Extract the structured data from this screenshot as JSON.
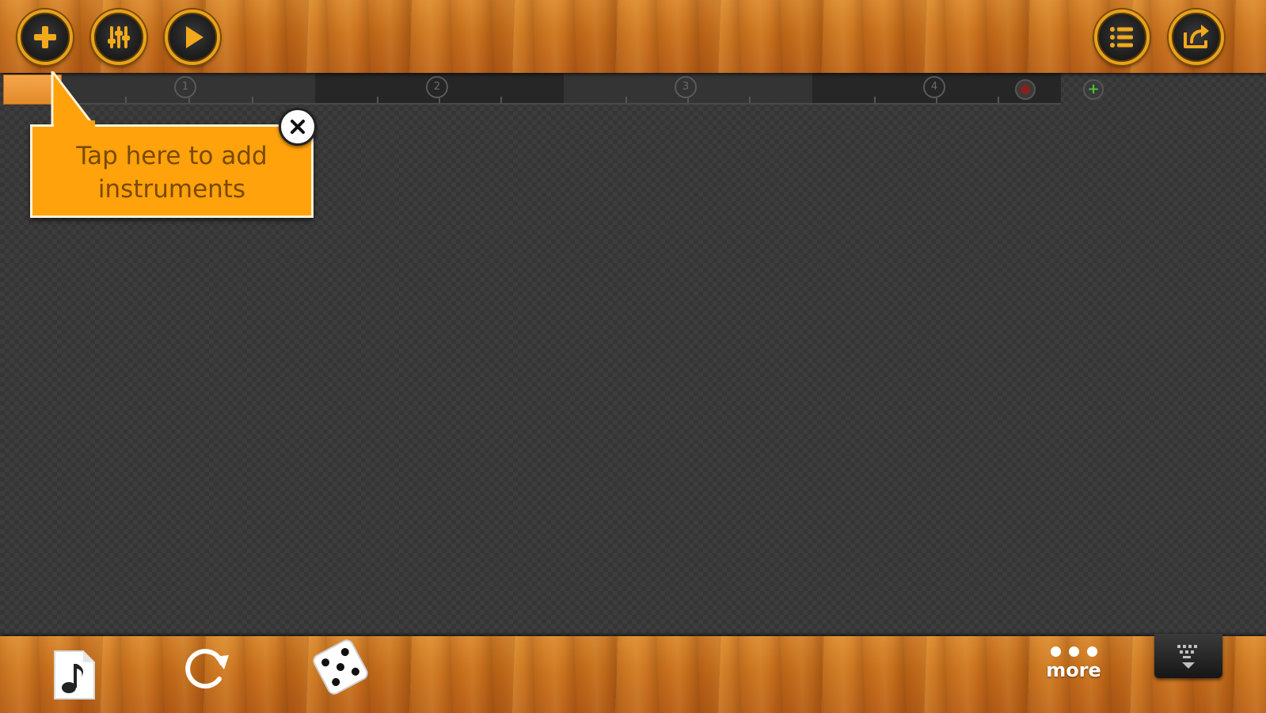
{
  "toolbar": {
    "left_buttons": [
      {
        "name": "add-instrument-button",
        "icon": "plus-icon"
      },
      {
        "name": "mixer-button",
        "icon": "sliders-icon"
      },
      {
        "name": "play-button",
        "icon": "play-icon"
      }
    ],
    "right_buttons": [
      {
        "name": "song-list-button",
        "icon": "list-icon"
      },
      {
        "name": "share-button",
        "icon": "share-icon"
      }
    ]
  },
  "timeline": {
    "measures": [
      "1",
      "2",
      "3",
      "4"
    ],
    "remove_icon": "minus-icon",
    "add_icon": "plus-icon",
    "add_label": "+"
  },
  "tooltip": {
    "text": "Tap here to add instruments",
    "close_icon": "close-icon"
  },
  "bottom_bar": {
    "buttons": [
      {
        "name": "music-file-button",
        "icon": "music-note-file-icon"
      },
      {
        "name": "loop-button",
        "icon": "refresh-icon"
      },
      {
        "name": "random-button",
        "icon": "dice-icon"
      }
    ],
    "more_label": "more",
    "keyboard_icon": "keyboard-hide-icon"
  },
  "colors": {
    "accent": "#e8a21a",
    "tooltip": "#ffa20c",
    "tooltip_text": "#7a4a00",
    "canvas": "#3d3d3d",
    "add_green": "#4fc233",
    "remove_red": "#8a1f1f"
  }
}
